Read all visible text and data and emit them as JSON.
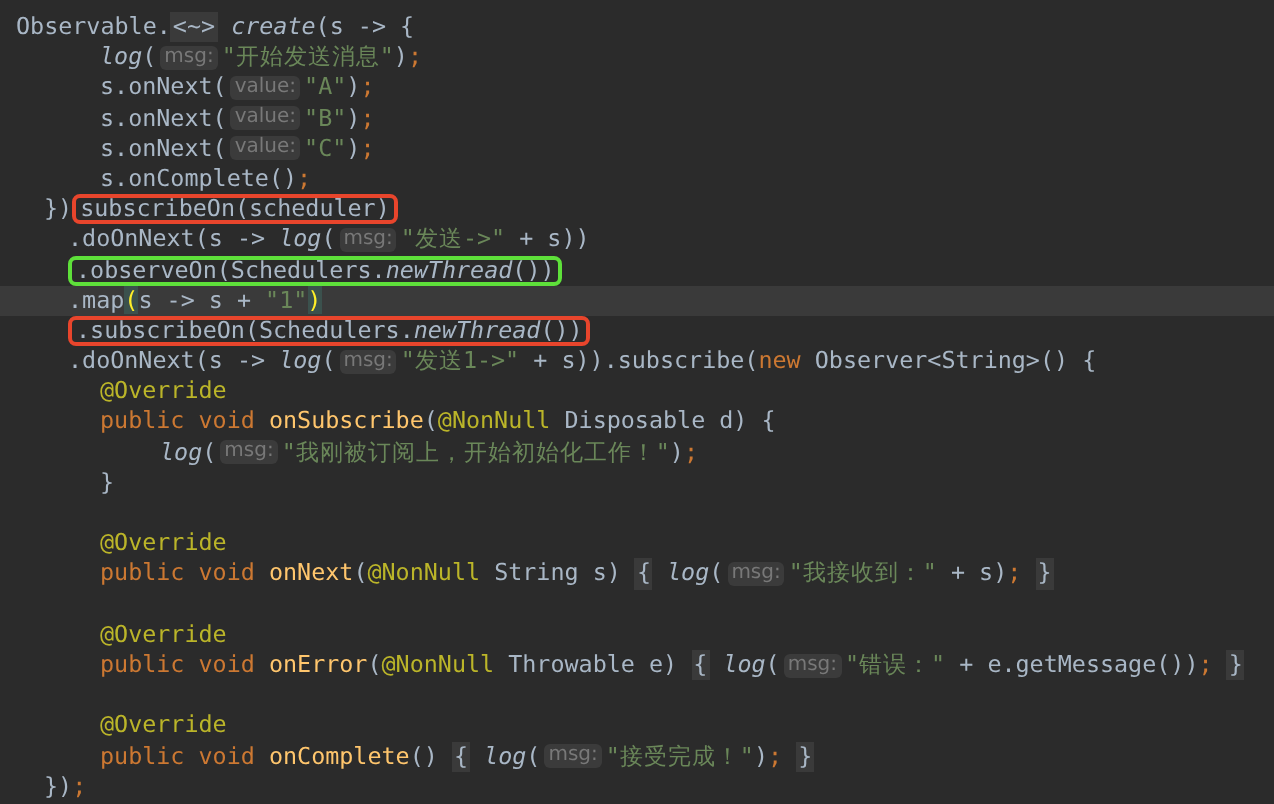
{
  "editor": {
    "lines": [
      {
        "current": false,
        "kind": "none",
        "tokens": [
          {
            "text": "Observable.",
            "kind": "plain"
          },
          {
            "text": "<~>",
            "kind": "fold"
          },
          {
            "text": " create",
            "kind": "call"
          },
          {
            "text": "(s -> {",
            "kind": "plain"
          }
        ]
      },
      {
        "current": false,
        "kind": "body",
        "tokens": [
          {
            "text": "log",
            "kind": "call"
          },
          {
            "text": "(",
            "kind": "plain"
          },
          {
            "text": "msg:",
            "kind": "hint"
          },
          {
            "text": "\"开始发送消息\"",
            "kind": "string"
          },
          {
            "text": ")",
            "kind": "plain"
          },
          {
            "text": ";",
            "kind": "punct"
          }
        ]
      },
      {
        "current": false,
        "kind": "body",
        "tokens": [
          {
            "text": "s.onNext(",
            "kind": "plain"
          },
          {
            "text": "value:",
            "kind": "hint"
          },
          {
            "text": "\"A\"",
            "kind": "string"
          },
          {
            "text": ")",
            "kind": "plain"
          },
          {
            "text": ";",
            "kind": "punct"
          }
        ]
      },
      {
        "current": false,
        "kind": "body",
        "tokens": [
          {
            "text": "s.onNext(",
            "kind": "plain"
          },
          {
            "text": "value:",
            "kind": "hint"
          },
          {
            "text": "\"B\"",
            "kind": "string"
          },
          {
            "text": ")",
            "kind": "plain"
          },
          {
            "text": ";",
            "kind": "punct"
          }
        ]
      },
      {
        "current": false,
        "kind": "body",
        "tokens": [
          {
            "text": "s.onNext(",
            "kind": "plain"
          },
          {
            "text": "value:",
            "kind": "hint"
          },
          {
            "text": "\"C\"",
            "kind": "string"
          },
          {
            "text": ")",
            "kind": "plain"
          },
          {
            "text": ";",
            "kind": "punct"
          }
        ]
      },
      {
        "current": false,
        "kind": "body",
        "tokens": [
          {
            "text": "s.onComplete()",
            "kind": "plain"
          },
          {
            "text": ";",
            "kind": "punct"
          }
        ]
      },
      {
        "current": false,
        "kind": "close",
        "tokens": [
          {
            "text": "})",
            "kind": "plain"
          },
          {
            "kind": "boxed",
            "color": "#e8452c",
            "parts": [
              {
                "text": "subscribeOn(scheduler)",
                "kind": "plain"
              }
            ]
          }
        ]
      },
      {
        "current": false,
        "kind": "chain",
        "tokens": [
          {
            "text": ".doOnNext(s -> ",
            "kind": "plain"
          },
          {
            "text": "log",
            "kind": "call"
          },
          {
            "text": "(",
            "kind": "plain"
          },
          {
            "text": "msg:",
            "kind": "hint"
          },
          {
            "text": "\"发送->\"",
            "kind": "string"
          },
          {
            "text": " + s))",
            "kind": "plain"
          }
        ]
      },
      {
        "current": false,
        "kind": "chain",
        "tokens": [
          {
            "kind": "boxed",
            "color": "#5ee03a",
            "parts": [
              {
                "text": ".observeOn(Schedulers.",
                "kind": "plain"
              },
              {
                "text": "newThread",
                "kind": "call"
              },
              {
                "text": "())",
                "kind": "plain"
              }
            ]
          }
        ]
      },
      {
        "current": true,
        "kind": "chain",
        "tokens": [
          {
            "text": ".map",
            "kind": "plain"
          },
          {
            "text": "(",
            "kind": "match"
          },
          {
            "text": "s -> s + ",
            "kind": "plain"
          },
          {
            "text": "\"1\"",
            "kind": "string"
          },
          {
            "text": ")",
            "kind": "match"
          }
        ]
      },
      {
        "current": false,
        "kind": "chain",
        "tokens": [
          {
            "kind": "boxed",
            "color": "#e8452c",
            "parts": [
              {
                "text": ".subscribeOn(Schedulers.",
                "kind": "plain"
              },
              {
                "text": "newThread",
                "kind": "call"
              },
              {
                "text": "())",
                "kind": "plain"
              }
            ]
          }
        ]
      },
      {
        "current": false,
        "kind": "chain",
        "tokens": [
          {
            "text": ".doOnNext(s -> ",
            "kind": "plain"
          },
          {
            "text": "log",
            "kind": "call"
          },
          {
            "text": "(",
            "kind": "plain"
          },
          {
            "text": "msg:",
            "kind": "hint"
          },
          {
            "text": "\"发送1->\"",
            "kind": "string"
          },
          {
            "text": " + s)).subscribe(",
            "kind": "plain"
          },
          {
            "text": "new",
            "kind": "keyword"
          },
          {
            "text": " Observer<String>() {",
            "kind": "plain"
          }
        ]
      },
      {
        "current": false,
        "kind": "body",
        "tokens": [
          {
            "text": "@Override",
            "kind": "annotation"
          }
        ]
      },
      {
        "current": false,
        "kind": "body",
        "tokens": [
          {
            "text": "public void ",
            "kind": "keyword"
          },
          {
            "text": "onSubscribe",
            "kind": "decl"
          },
          {
            "text": "(",
            "kind": "plain"
          },
          {
            "text": "@NonNull",
            "kind": "annotation"
          },
          {
            "text": " Disposable d) {",
            "kind": "plain"
          }
        ]
      },
      {
        "current": false,
        "kind": "inner",
        "tokens": [
          {
            "text": "log",
            "kind": "call"
          },
          {
            "text": "(",
            "kind": "plain"
          },
          {
            "text": "msg:",
            "kind": "hint"
          },
          {
            "text": "\"我刚被订阅上，开始初始化工作！\"",
            "kind": "string"
          },
          {
            "text": ")",
            "kind": "plain"
          },
          {
            "text": ";",
            "kind": "punct"
          }
        ]
      },
      {
        "current": false,
        "kind": "body",
        "tokens": [
          {
            "text": "}",
            "kind": "plain"
          }
        ]
      },
      {
        "current": false,
        "kind": "none"
      },
      {
        "current": false,
        "kind": "body",
        "tokens": [
          {
            "text": "@Override",
            "kind": "annotation"
          }
        ]
      },
      {
        "current": false,
        "kind": "body",
        "tokens": [
          {
            "text": "public void ",
            "kind": "keyword"
          },
          {
            "text": "onNext",
            "kind": "decl"
          },
          {
            "text": "(",
            "kind": "plain"
          },
          {
            "text": "@NonNull",
            "kind": "annotation"
          },
          {
            "text": " String s) ",
            "kind": "plain"
          },
          {
            "text": "{",
            "kind": "fold"
          },
          {
            "text": " log",
            "kind": "call"
          },
          {
            "text": "(",
            "kind": "plain"
          },
          {
            "text": "msg:",
            "kind": "hint"
          },
          {
            "text": "\"我接收到：\"",
            "kind": "string"
          },
          {
            "text": " + s)",
            "kind": "plain"
          },
          {
            "text": "; ",
            "kind": "punct"
          },
          {
            "text": "}",
            "kind": "fold"
          }
        ]
      },
      {
        "current": false,
        "kind": "none"
      },
      {
        "current": false,
        "kind": "body",
        "tokens": [
          {
            "text": "@Override",
            "kind": "annotation"
          }
        ]
      },
      {
        "current": false,
        "kind": "body",
        "tokens": [
          {
            "text": "public void ",
            "kind": "keyword"
          },
          {
            "text": "onError",
            "kind": "decl"
          },
          {
            "text": "(",
            "kind": "plain"
          },
          {
            "text": "@NonNull",
            "kind": "annotation"
          },
          {
            "text": " Throwable e) ",
            "kind": "plain"
          },
          {
            "text": "{",
            "kind": "fold"
          },
          {
            "text": " log",
            "kind": "call"
          },
          {
            "text": "(",
            "kind": "plain"
          },
          {
            "text": "msg:",
            "kind": "hint"
          },
          {
            "text": "\"错误：\"",
            "kind": "string"
          },
          {
            "text": " + e.getMessage())",
            "kind": "plain"
          },
          {
            "text": "; ",
            "kind": "punct"
          },
          {
            "text": "}",
            "kind": "fold"
          }
        ]
      },
      {
        "current": false,
        "kind": "none"
      },
      {
        "current": false,
        "kind": "body",
        "tokens": [
          {
            "text": "@Override",
            "kind": "annotation"
          }
        ]
      },
      {
        "current": false,
        "kind": "body",
        "tokens": [
          {
            "text": "public void ",
            "kind": "keyword"
          },
          {
            "text": "onComplete",
            "kind": "decl"
          },
          {
            "text": "() ",
            "kind": "plain"
          },
          {
            "text": "{",
            "kind": "fold"
          },
          {
            "text": " log",
            "kind": "call"
          },
          {
            "text": "(",
            "kind": "plain"
          },
          {
            "text": "msg:",
            "kind": "hint"
          },
          {
            "text": "\"接受完成！\"",
            "kind": "string"
          },
          {
            "text": ")",
            "kind": "plain"
          },
          {
            "text": "; ",
            "kind": "punct"
          },
          {
            "text": "}",
            "kind": "fold"
          }
        ]
      },
      {
        "current": false,
        "kind": "close",
        "tokens": [
          {
            "text": "})",
            "kind": "plain"
          },
          {
            "text": ";",
            "kind": "punct"
          }
        ]
      }
    ]
  }
}
